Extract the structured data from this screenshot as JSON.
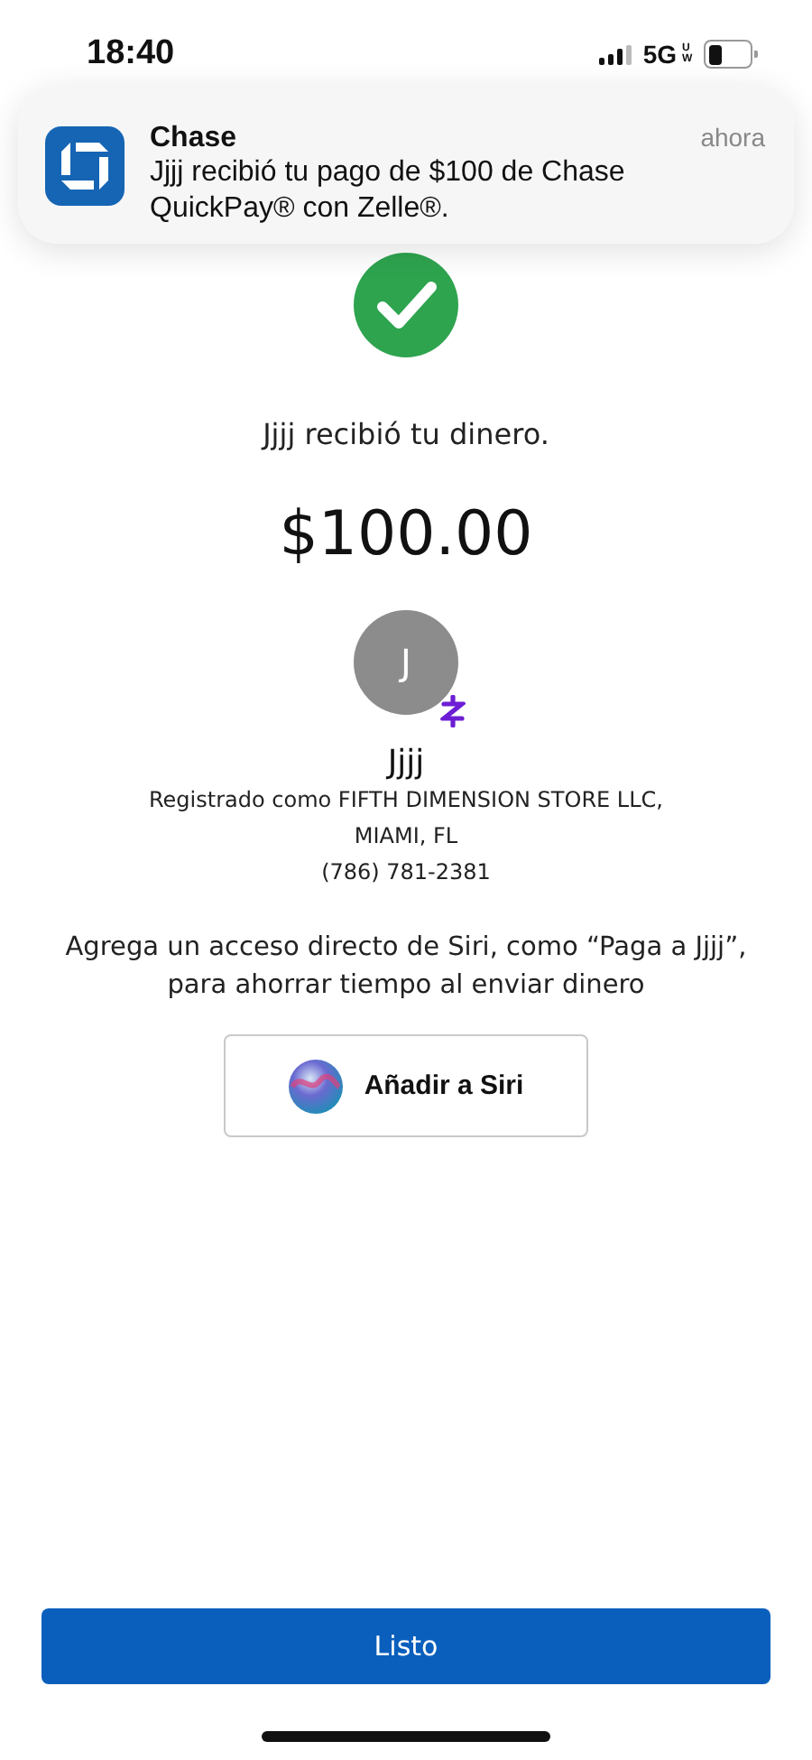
{
  "status_bar": {
    "time": "18:40",
    "network": "5G",
    "network_badge": "UW"
  },
  "notification": {
    "app": "Chase",
    "time": "ahora",
    "message": "Jjjj recibió tu pago de $100 de Chase QuickPay® con Zelle®."
  },
  "confirmation": {
    "message": "Jjjj recibió tu dinero.",
    "amount": "$100.00"
  },
  "recipient": {
    "initial": "J",
    "name": "Jjjj",
    "registered": "Registrado como FIFTH DIMENSION STORE LLC,",
    "location": "MIAMI, FL",
    "phone": "(786) 781-2381"
  },
  "siri": {
    "prompt": "Agrega un acceso directo de Siri, como “Paga a Jjjj”, para ahorrar tiempo al enviar dinero",
    "button": "Añadir a Siri"
  },
  "done_button": "Listo"
}
